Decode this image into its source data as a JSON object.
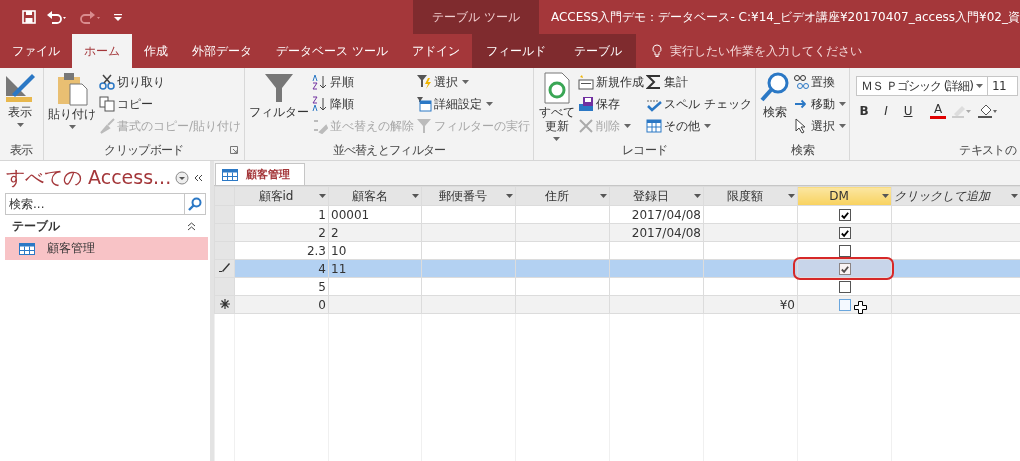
{
  "window": {
    "title": "ACCESS入門デモ：データベース- C:¥14_ビデオ講座¥20170407_access入門¥02_資",
    "contextual_group": "テーブル ツール"
  },
  "tabs": [
    {
      "label": "ファイル",
      "selected": false,
      "contextual": false
    },
    {
      "label": "ホーム",
      "selected": true,
      "contextual": false
    },
    {
      "label": "作成",
      "selected": false,
      "contextual": false
    },
    {
      "label": "外部データ",
      "selected": false,
      "contextual": false
    },
    {
      "label": "データベース ツール",
      "selected": false,
      "contextual": false
    },
    {
      "label": "アドイン",
      "selected": false,
      "contextual": false
    },
    {
      "label": "フィールド",
      "selected": false,
      "contextual": true
    },
    {
      "label": "テーブル",
      "selected": false,
      "contextual": true
    }
  ],
  "tell_me": {
    "placeholder": "実行したい作業を入力してください"
  },
  "ribbon_groups": [
    {
      "label": "表示",
      "launcher": false,
      "large": [
        {
          "label": "表示",
          "dropdown": true,
          "disabled": false
        }
      ]
    },
    {
      "label": "クリップボード",
      "launcher": true,
      "large": [
        {
          "label": "貼り付け",
          "dropdown": true,
          "disabled": false
        }
      ],
      "small": [
        {
          "label": "切り取り",
          "dropdown": false,
          "disabled": false
        },
        {
          "label": "コピー",
          "dropdown": false,
          "disabled": false
        },
        {
          "label": "書式のコピー/貼り付け",
          "dropdown": false,
          "disabled": true
        }
      ]
    },
    {
      "label": "並べ替えとフィルター",
      "launcher": false,
      "large": [
        {
          "label": "フィルター",
          "dropdown": false,
          "disabled": false
        }
      ],
      "small": [
        {
          "label": "昇順",
          "dropdown": false,
          "disabled": false
        },
        {
          "label": "降順",
          "dropdown": false,
          "disabled": false
        },
        {
          "label": "並べ替えの解除",
          "dropdown": false,
          "disabled": true
        },
        {
          "label": "選択",
          "dropdown": true,
          "disabled": false
        },
        {
          "label": "詳細設定",
          "dropdown": true,
          "disabled": false
        },
        {
          "label": "フィルターの実行",
          "dropdown": false,
          "disabled": true
        }
      ]
    },
    {
      "label": "レコード",
      "launcher": false,
      "large": [
        {
          "label": "すべて更新",
          "dropdown": true,
          "disabled": false,
          "two_line": true
        }
      ],
      "small": [
        {
          "label": "新規作成",
          "dropdown": false,
          "disabled": false
        },
        {
          "label": "保存",
          "dropdown": false,
          "disabled": false
        },
        {
          "label": "削除",
          "dropdown": true,
          "disabled": true
        },
        {
          "label": "集計",
          "dropdown": false,
          "disabled": false
        },
        {
          "label": "スペル チェック",
          "dropdown": false,
          "disabled": false
        },
        {
          "label": "その他",
          "dropdown": true,
          "disabled": false
        }
      ]
    },
    {
      "label": "検索",
      "launcher": false,
      "large": [
        {
          "label": "検索",
          "dropdown": false,
          "disabled": false
        }
      ],
      "small": [
        {
          "label": "置換",
          "dropdown": false,
          "disabled": false
        },
        {
          "label": "移動",
          "dropdown": true,
          "disabled": false
        },
        {
          "label": "選択",
          "dropdown": true,
          "disabled": false
        }
      ]
    }
  ],
  "text_format": {
    "label": "テキストの",
    "font": "ＭＳ Ｐゴシック (詳細)",
    "size": "11",
    "buttons": [
      "B",
      "I",
      "U",
      "A"
    ]
  },
  "nav_pane": {
    "title": "すべての Access...",
    "search": {
      "placeholder": "検索..."
    },
    "sections": [
      {
        "label": "テーブル",
        "expanded": true,
        "items": [
          {
            "label": "顧客管理",
            "selected": true
          }
        ]
      }
    ]
  },
  "document_tab": {
    "label": "顧客管理"
  },
  "table": {
    "columns": [
      {
        "label": "顧客id",
        "selected": false
      },
      {
        "label": "顧客名",
        "selected": false
      },
      {
        "label": "郵便番号",
        "selected": false
      },
      {
        "label": "住所",
        "selected": false
      },
      {
        "label": "登録日",
        "selected": false
      },
      {
        "label": "限度額",
        "selected": false
      },
      {
        "label": "DM",
        "selected": true
      },
      {
        "label": "クリックして追加",
        "selected": false
      }
    ],
    "rows": [
      {
        "kind": "normal",
        "selected": false,
        "annotated": false,
        "cells": [
          "1",
          "00001",
          "",
          "",
          "2017/04/08",
          ""
        ],
        "dm": true
      },
      {
        "kind": "normal",
        "selected": false,
        "annotated": false,
        "cells": [
          "2",
          "2",
          "",
          "",
          "2017/04/08",
          ""
        ],
        "dm": true
      },
      {
        "kind": "normal",
        "selected": false,
        "annotated": false,
        "cells": [
          "2.3",
          "10",
          "",
          "",
          "",
          ""
        ],
        "dm": false
      },
      {
        "kind": "editing",
        "selected": true,
        "annotated": true,
        "cells": [
          "4",
          "11",
          "",
          "",
          "",
          ""
        ],
        "dm": true
      },
      {
        "kind": "normal",
        "selected": false,
        "annotated": false,
        "cells": [
          "5",
          "",
          "",
          "",
          "",
          ""
        ],
        "dm": false
      },
      {
        "kind": "new",
        "selected": false,
        "annotated": false,
        "cells": [
          "0",
          "",
          "",
          "",
          "",
          "¥0"
        ],
        "dm": false
      }
    ]
  }
}
